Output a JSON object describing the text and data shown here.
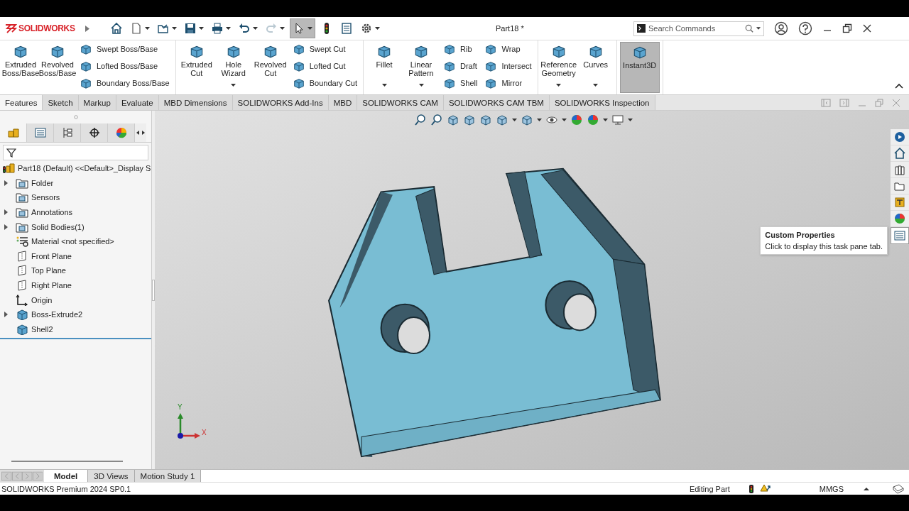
{
  "window": {
    "app": "SOLIDWORKS",
    "title": "Part18 *"
  },
  "quick_access": [
    {
      "kind": "home",
      "selected": false,
      "disabled": false
    },
    {
      "kind": "new",
      "selected": false,
      "disabled": false
    },
    {
      "kind": "open",
      "selected": false,
      "disabled": false
    },
    {
      "kind": "save",
      "selected": false,
      "disabled": false
    },
    {
      "kind": "print",
      "selected": false,
      "disabled": false
    },
    {
      "kind": "undo",
      "selected": false,
      "disabled": false
    },
    {
      "kind": "redo",
      "selected": false,
      "disabled": true
    },
    {
      "kind": "select",
      "selected": true,
      "disabled": false
    },
    {
      "kind": "rebuild",
      "selected": false,
      "disabled": false
    },
    {
      "kind": "file-properties",
      "selected": false,
      "disabled": false
    },
    {
      "kind": "options",
      "selected": false,
      "disabled": false
    }
  ],
  "search": {
    "placeholder": "Search Commands"
  },
  "ribbon": [
    {
      "columns": [
        {
          "kind": "large",
          "label": "Extruded Boss/Base",
          "dropdown": false,
          "selected": false
        },
        {
          "kind": "large",
          "label": "Revolved Boss/Base",
          "dropdown": false,
          "selected": false
        },
        {
          "kind": "stack",
          "items": [
            "Swept Boss/Base",
            "Lofted Boss/Base",
            "Boundary Boss/Base"
          ]
        }
      ]
    },
    {
      "columns": [
        {
          "kind": "large",
          "label": "Extruded Cut",
          "dropdown": false,
          "selected": false
        },
        {
          "kind": "large",
          "label": "Hole Wizard",
          "dropdown": true,
          "selected": false
        },
        {
          "kind": "large",
          "label": "Revolved Cut",
          "dropdown": false,
          "selected": false
        },
        {
          "kind": "stack",
          "items": [
            "Swept Cut",
            "Lofted Cut",
            "Boundary Cut"
          ]
        }
      ]
    },
    {
      "columns": [
        {
          "kind": "large",
          "label": "Fillet",
          "dropdown": true,
          "selected": false
        },
        {
          "kind": "large",
          "label": "Linear Pattern",
          "dropdown": true,
          "selected": false
        },
        {
          "kind": "stack",
          "items": [
            "Rib",
            "Draft",
            "Shell"
          ]
        },
        {
          "kind": "stack",
          "items": [
            "Wrap",
            "Intersect",
            "Mirror"
          ]
        }
      ]
    },
    {
      "columns": [
        {
          "kind": "large",
          "label": "Reference Geometry",
          "dropdown": true,
          "selected": false
        },
        {
          "kind": "large",
          "label": "Curves",
          "dropdown": true,
          "selected": false
        }
      ]
    },
    {
      "columns": [
        {
          "kind": "large",
          "label": "Instant3D",
          "dropdown": false,
          "selected": true
        }
      ]
    }
  ],
  "command_tabs": [
    {
      "label": "Features",
      "selected": true
    },
    {
      "label": "Sketch",
      "selected": false
    },
    {
      "label": "Markup",
      "selected": false
    },
    {
      "label": "Evaluate",
      "selected": false
    },
    {
      "label": "MBD Dimensions",
      "selected": false
    },
    {
      "label": "SOLIDWORKS Add-Ins",
      "selected": false
    },
    {
      "label": "MBD",
      "selected": false
    },
    {
      "label": "SOLIDWORKS CAM",
      "selected": false
    },
    {
      "label": "SOLIDWORKS CAM TBM",
      "selected": false
    },
    {
      "label": "SOLIDWORKS Inspection",
      "selected": false
    }
  ],
  "tree": {
    "root": "Part18 (Default) <<Default>_Display S",
    "items": [
      {
        "label": "Folder",
        "kind": "folder",
        "collapsible": true
      },
      {
        "label": "Sensors",
        "kind": "folder",
        "collapsible": false
      },
      {
        "label": "Annotations",
        "kind": "folder",
        "collapsible": true
      },
      {
        "label": "Solid Bodies(1)",
        "kind": "folder",
        "collapsible": true
      },
      {
        "label": "Material <not specified>",
        "kind": "material",
        "collapsible": false
      },
      {
        "label": "Front Plane",
        "kind": "plane",
        "collapsible": false
      },
      {
        "label": "Top Plane",
        "kind": "plane",
        "collapsible": false
      },
      {
        "label": "Right Plane",
        "kind": "plane",
        "collapsible": false
      },
      {
        "label": "Origin",
        "kind": "origin",
        "collapsible": false
      },
      {
        "label": "Boss-Extrude2",
        "kind": "feature",
        "collapsible": true
      },
      {
        "label": "Shell2",
        "kind": "feature",
        "collapsible": false
      }
    ]
  },
  "triad": {
    "x": "X",
    "y": "Y"
  },
  "task_pane": [
    {
      "selected": false
    },
    {
      "selected": false
    },
    {
      "selected": false
    },
    {
      "selected": false
    },
    {
      "selected": false
    },
    {
      "selected": false
    },
    {
      "selected": true
    }
  ],
  "tooltip": {
    "title": "Custom Properties",
    "text": "Click to display this task pane tab."
  },
  "bottom_tabs": [
    {
      "label": "Model",
      "selected": true
    },
    {
      "label": "3D Views",
      "selected": false
    },
    {
      "label": "Motion Study 1",
      "selected": false
    }
  ],
  "status_bar": {
    "product": "SOLIDWORKS Premium 2024 SP0.1",
    "mode": "Editing Part",
    "units": "MMGS"
  }
}
